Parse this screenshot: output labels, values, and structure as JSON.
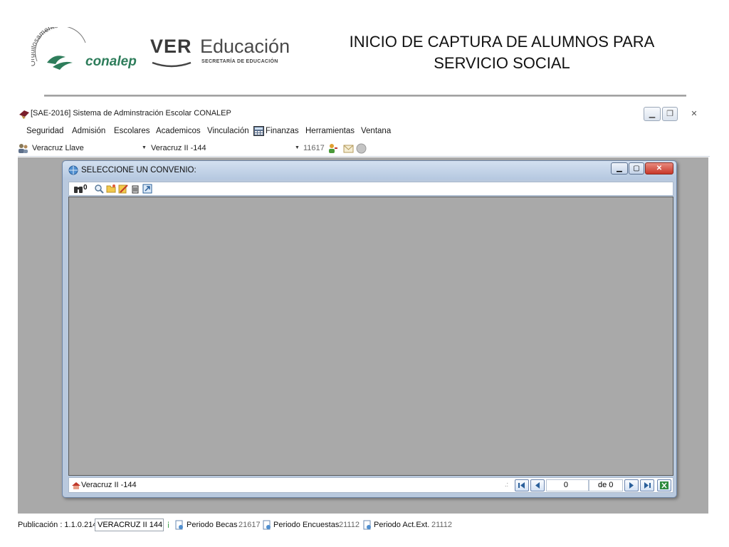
{
  "slide": {
    "title_line1": "INICIO DE CAPTURA DE ALUMNOS PARA",
    "title_line2": "SERVICIO SOCIAL",
    "logo_conalep": {
      "tagline": "Orgullosamente",
      "name": "conalep",
      "color": "#2e7d5b"
    },
    "logo_ver": {
      "mark": "VER",
      "name": "Educación",
      "subtitle": "SECRETARÍA DE EDUCACIÓN"
    }
  },
  "app": {
    "title": "[SAE-2016] Sistema de Adminstración Escolar CONALEP",
    "window_buttons": [
      "minimize-icon",
      "restore-icon",
      "close-icon"
    ],
    "menu": [
      {
        "label": "Seguridad"
      },
      {
        "label": "Admisión"
      },
      {
        "label": "Escolares"
      },
      {
        "label": "Academicos"
      },
      {
        "label": "Vinculación"
      },
      {
        "label": "Finanzas",
        "icon": "calculator-icon"
      },
      {
        "label": "Herramientas"
      },
      {
        "label": "Ventana"
      }
    ],
    "toolbar": {
      "state_select": "Veracruz Llave",
      "plantel_select": "Veracruz II -144",
      "period": "11617"
    },
    "statusbar": {
      "publication": "Publicación : 1.1.0.214",
      "plantel": "VERACRUZ II 144 -",
      "items": [
        {
          "label": "Periodo Becas",
          "value": "21617"
        },
        {
          "label": "Periodo Encuestas",
          "value": "21112"
        },
        {
          "label": "Periodo Act.Ext.",
          "value": "21112"
        }
      ]
    }
  },
  "dialog": {
    "title": "SELECCIONE UN CONVENIO:",
    "toolbar_count": "0",
    "status_text": "Veracruz II -144",
    "nav": {
      "record": "0",
      "of_label": "de 0"
    }
  },
  "colors": {
    "mdi_background": "#a9a9a9",
    "dialog_frame": "#b9c9de",
    "close_button": "#d9453a"
  }
}
